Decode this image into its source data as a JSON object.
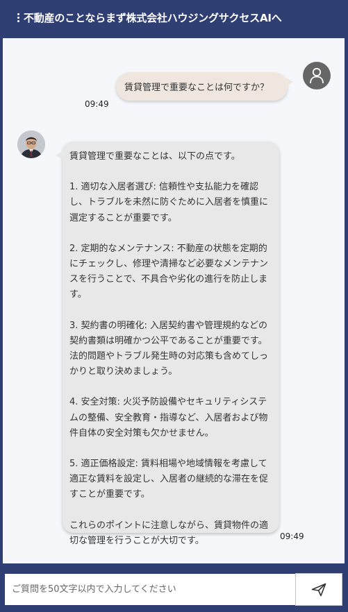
{
  "header": {
    "title": "不動産のことならまず株式会社ハウジングサクセスAIへ"
  },
  "messages": {
    "user": {
      "text": "賃貸管理で重要なことは何ですか？",
      "time": "09:49"
    },
    "bot": {
      "time": "09:49",
      "paragraphs": [
        "賃貸管理で重要なことは、以下の点です。",
        "1. 適切な入居者選び: 信頼性や支払能力を確認し、トラブルを未然に防ぐために入居者を慎重に選定することが重要です。",
        "2. 定期的なメンテナンス: 不動産の状態を定期的にチェックし、修理や清掃など必要なメンテナンスを行うことで、不具合や劣化の進行を防止します。",
        "3. 契約書の明確化: 入居契約書や管理規約などの契約書類は明確かつ公平であることが重要です。法的問題やトラブル発生時の対応策も含めてしっかりと取り決めましょう。",
        "4. 安全対策: 火災予防設備やセキュリティシステムの整備、安全教育・指導など、入居者および物件自体の安全対策も欠かせません。",
        "5. 適正価格設定: 賃料相場や地域情報を考慮して適正な賃料を設定し、入居者の継続的な滞在を促すことが重要です。",
        "これらのポイントに注意しながら、賃貸物件の適切な管理を行うことが大切です。"
      ]
    }
  },
  "input": {
    "placeholder": "ご質問を50文字以内で入力してください",
    "value": ""
  },
  "colors": {
    "header_bg": "#2f3e73",
    "chat_bg": "#f5f7fb",
    "user_bubble": "#efe7df",
    "bot_bubble": "#e8e8e8"
  },
  "icons": {
    "menu": "kebab-menu-icon",
    "user_avatar": "user-avatar-icon",
    "send": "send-paper-plane-icon"
  }
}
